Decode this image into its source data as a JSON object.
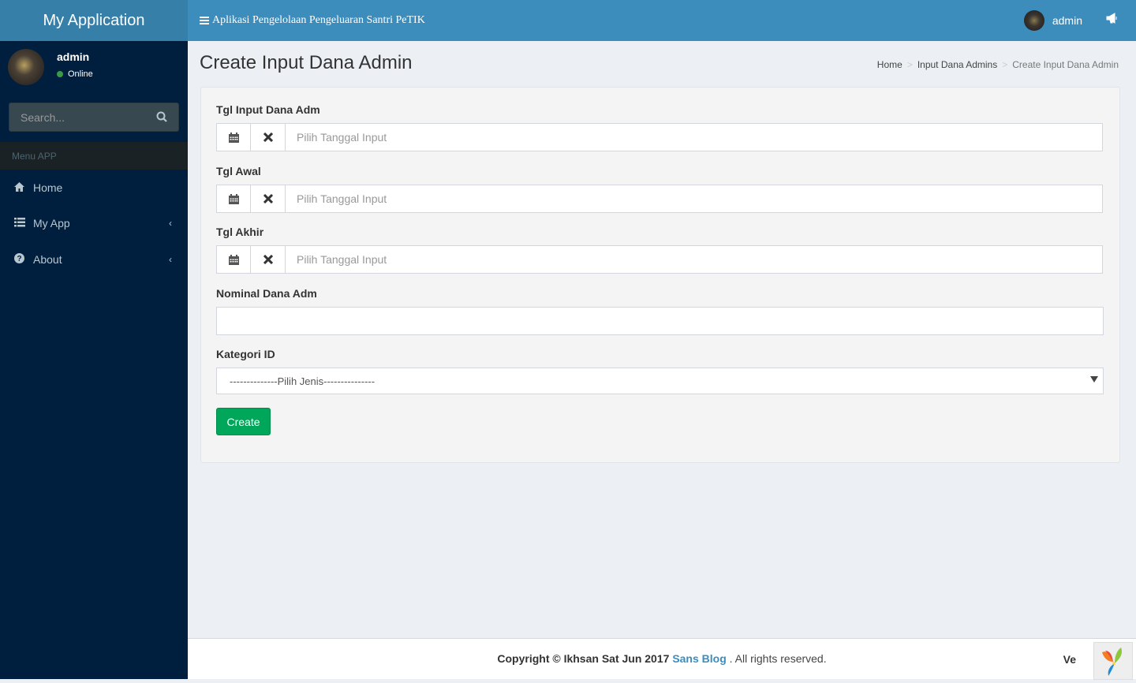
{
  "header": {
    "logo": "My Application",
    "app_title": "Aplikasi Pengelolaan Pengeluaran Santri PeTIK",
    "user": "admin"
  },
  "sidebar": {
    "user_name": "admin",
    "user_status": "Online",
    "search_placeholder": "Search...",
    "menu_header": "Menu APP",
    "items": [
      {
        "label": "Home",
        "icon": "home-icon"
      },
      {
        "label": "My App",
        "icon": "list-icon",
        "has_children": true
      },
      {
        "label": "About",
        "icon": "question-circle-icon",
        "has_children": true
      }
    ]
  },
  "page": {
    "title": "Create Input Dana Admin",
    "breadcrumb": [
      "Home",
      "Input Dana Admins",
      "Create Input Dana Admin"
    ]
  },
  "form": {
    "fields": [
      {
        "label": "Tgl Input Dana Adm",
        "placeholder": "Pilih Tanggal Input",
        "value": ""
      },
      {
        "label": "Tgl Awal",
        "placeholder": "Pilih Tanggal Input",
        "value": ""
      },
      {
        "label": "Tgl Akhir",
        "placeholder": "Pilih Tanggal Input",
        "value": ""
      }
    ],
    "nominal_label": "Nominal Dana Adm",
    "nominal_value": "",
    "kategori_label": "Kategori ID",
    "kategori_selected": "--------------Pilih Jenis---------------",
    "submit_label": "Create"
  },
  "footer": {
    "copyright": "Copyright © Ikhsan Sat Jun 2017",
    "link": "Sans Blog",
    "suffix": ". All rights reserved.",
    "version_prefix": "Ve"
  },
  "colors": {
    "brand": "#3c8dbc",
    "sidebar": "#001f3f",
    "success": "#00a65a"
  }
}
